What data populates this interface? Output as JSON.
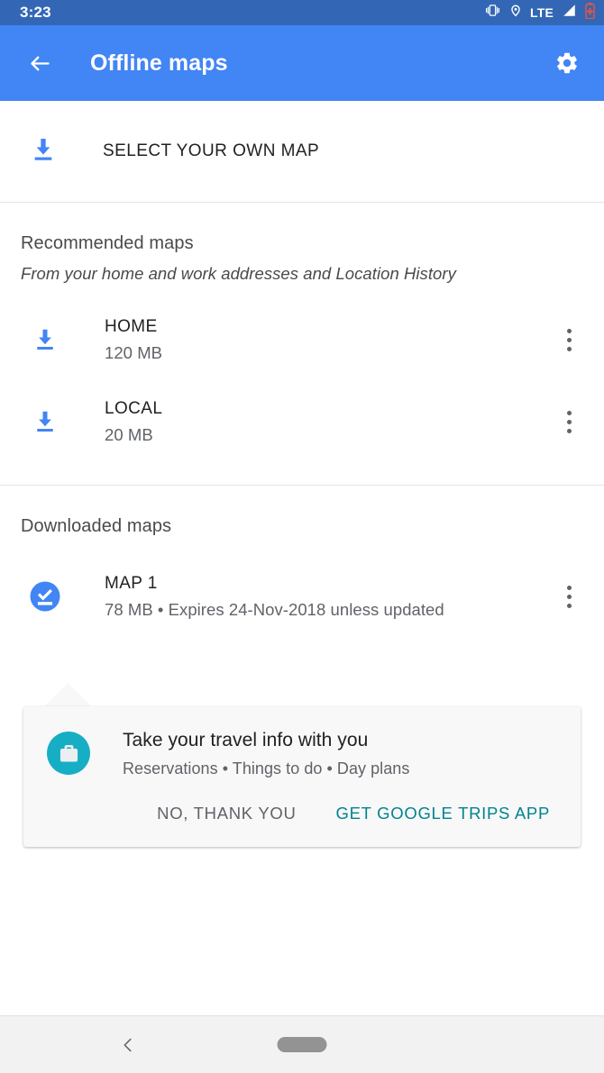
{
  "status_bar": {
    "time": "3:23",
    "icons": [
      "vibrate-icon",
      "location-pin-icon",
      "signal-icon",
      "battery-charging-icon"
    ],
    "network_label": "LTE",
    "background": "#3367b5"
  },
  "app_bar": {
    "title": "Offline maps",
    "back_icon": "arrow-back-icon",
    "settings_icon": "gear-icon",
    "background": "#4285f4"
  },
  "select_own_map": {
    "label": "SELECT YOUR OWN MAP",
    "icon": "download-icon",
    "icon_color": "#4285f4"
  },
  "recommended": {
    "title": "Recommended maps",
    "subtitle": "From your home and work addresses and Location History",
    "items": [
      {
        "name": "HOME",
        "size": "120 MB",
        "icon": "download-icon",
        "menu_icon": "more-vert-icon"
      },
      {
        "name": "LOCAL",
        "size": "20 MB",
        "icon": "download-icon",
        "menu_icon": "more-vert-icon"
      }
    ]
  },
  "downloaded": {
    "title": "Downloaded maps",
    "items": [
      {
        "name": "MAP 1",
        "details": "78 MB • Expires 24-Nov-2018 unless updated",
        "icon": "downloaded-check-icon",
        "menu_icon": "more-vert-icon"
      }
    ]
  },
  "promo_card": {
    "icon": "travel-bag-icon",
    "icon_color": "#16aec4",
    "title": "Take your travel info with you",
    "subtitle": "Reservations • Things to do • Day plans",
    "dismiss_label": "NO, THANK YOU",
    "action_label": "GET GOOGLE TRIPS APP",
    "action_color": "#00838f"
  },
  "nav_bar": {
    "back_icon": "chevron-back-icon",
    "home_icon": "home-pill-icon"
  }
}
